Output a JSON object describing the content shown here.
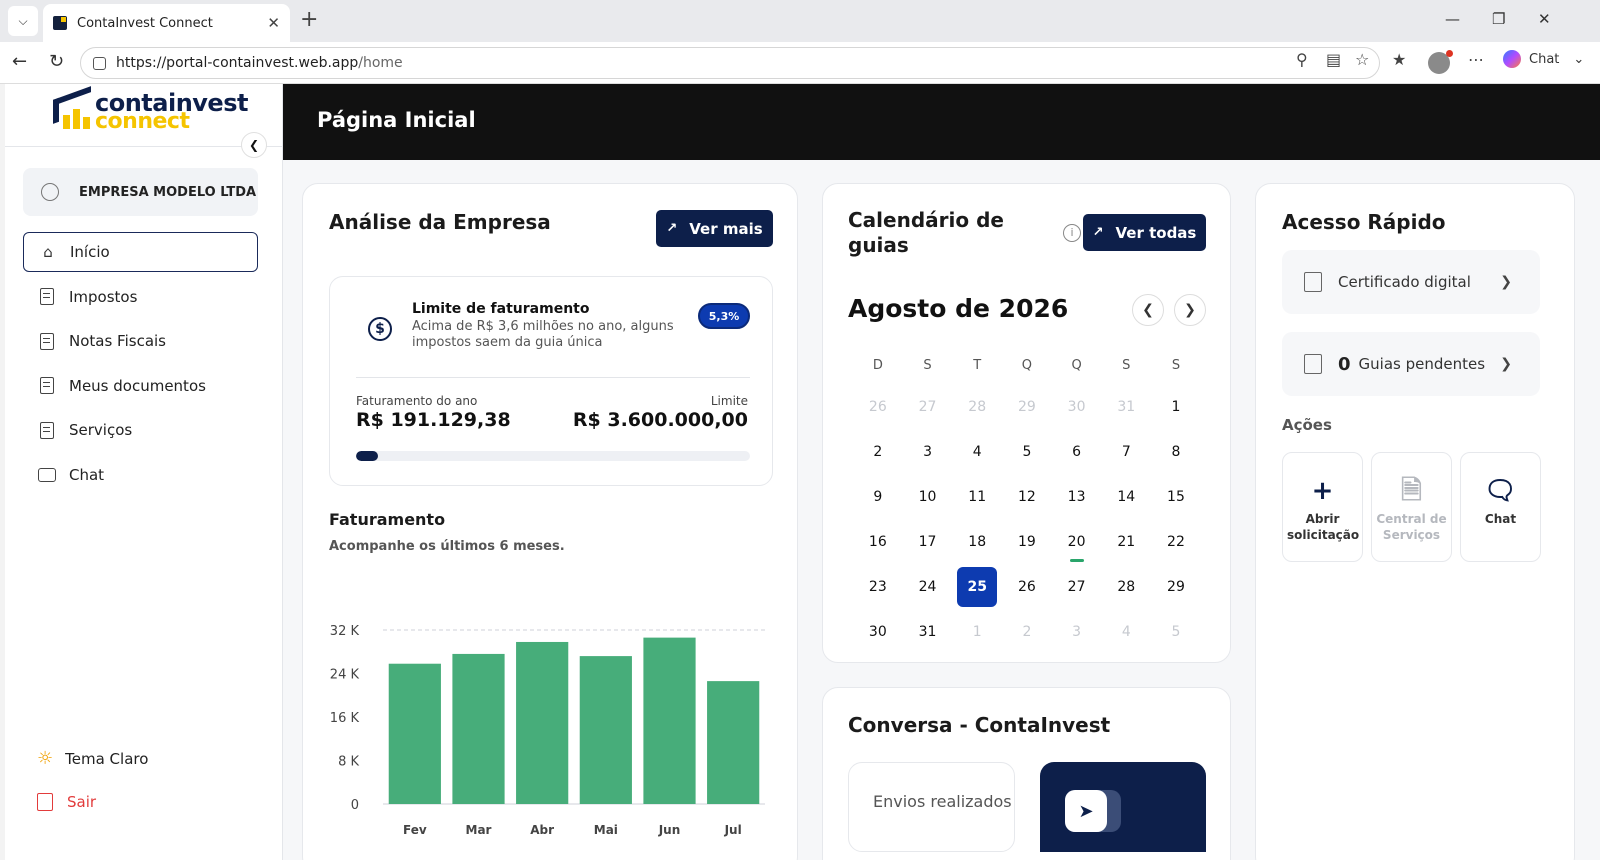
{
  "browser": {
    "tab_title": "ContaInvest Connect",
    "url_host": "https://portal-containvest.web.app",
    "url_path": "/home",
    "chat_label": "Chat"
  },
  "brand": {
    "line1": "containvest",
    "line2": "connect"
  },
  "sidebar": {
    "company": "EMPRESA MODELO LTDA",
    "items": [
      {
        "label": "Início",
        "icon": "home-icon"
      },
      {
        "label": "Impostos",
        "icon": "tax-icon"
      },
      {
        "label": "Notas Fiscais",
        "icon": "invoice-icon"
      },
      {
        "label": "Meus documentos",
        "icon": "document-icon"
      },
      {
        "label": "Serviços",
        "icon": "clipboard-icon"
      },
      {
        "label": "Chat",
        "icon": "chat-icon"
      }
    ],
    "theme_label": "Tema Claro",
    "logout_label": "Sair"
  },
  "header": {
    "title": "Página Inicial"
  },
  "analysis": {
    "title": "Análise da Empresa",
    "button": "Ver mais",
    "limit_title": "Limite de faturamento",
    "limit_desc": "Acima de R$ 3,6 milhões no ano, alguns impostos saem da guia única",
    "percent": "5,3%",
    "progress_fraction": 0.053,
    "revenue_label": "Faturamento do ano",
    "revenue_value": "R$ 191.129,38",
    "limit_label": "Limite",
    "limit_value": "R$ 3.600.000,00",
    "chart_title": "Faturamento",
    "chart_subtitle": "Acompanhe os últimos 6 meses."
  },
  "chart_data": {
    "type": "bar",
    "categories": [
      "Fev",
      "Mar",
      "Abr",
      "Mai",
      "Jun",
      "Jul"
    ],
    "values": [
      25800,
      27600,
      29800,
      27200,
      30600,
      22600
    ],
    "ylim": [
      0,
      32000
    ],
    "yticks": [
      "0",
      "8 K",
      "16 K",
      "24 K",
      "32 K"
    ],
    "ytick_values": [
      0,
      8000,
      16000,
      24000,
      32000
    ],
    "color": "#47ad7a",
    "grid": "dashed top line"
  },
  "calendar": {
    "title": "Calendário de guias",
    "button": "Ver todas",
    "month": "Agosto de 2026",
    "weekdays": [
      "D",
      "S",
      "T",
      "Q",
      "Q",
      "S",
      "S"
    ],
    "weeks": [
      [
        {
          "d": "26",
          "m": 1
        },
        {
          "d": "27",
          "m": 1
        },
        {
          "d": "28",
          "m": 1
        },
        {
          "d": "29",
          "m": 1
        },
        {
          "d": "30",
          "m": 1
        },
        {
          "d": "31",
          "m": 1
        },
        {
          "d": "1"
        }
      ],
      [
        {
          "d": "2"
        },
        {
          "d": "3"
        },
        {
          "d": "4"
        },
        {
          "d": "5"
        },
        {
          "d": "6"
        },
        {
          "d": "7"
        },
        {
          "d": "8"
        }
      ],
      [
        {
          "d": "9"
        },
        {
          "d": "10"
        },
        {
          "d": "11"
        },
        {
          "d": "12"
        },
        {
          "d": "13"
        },
        {
          "d": "14"
        },
        {
          "d": "15"
        }
      ],
      [
        {
          "d": "16"
        },
        {
          "d": "17"
        },
        {
          "d": "18"
        },
        {
          "d": "19"
        },
        {
          "d": "20",
          "e": 1
        },
        {
          "d": "21"
        },
        {
          "d": "22"
        }
      ],
      [
        {
          "d": "23"
        },
        {
          "d": "24"
        },
        {
          "d": "25",
          "t": 1
        },
        {
          "d": "26"
        },
        {
          "d": "27"
        },
        {
          "d": "28"
        },
        {
          "d": "29"
        }
      ],
      [
        {
          "d": "30"
        },
        {
          "d": "31"
        },
        {
          "d": "1",
          "m": 1
        },
        {
          "d": "2",
          "m": 1
        },
        {
          "d": "3",
          "m": 1
        },
        {
          "d": "4",
          "m": 1
        },
        {
          "d": "5",
          "m": 1
        }
      ]
    ]
  },
  "conversa": {
    "title": "Conversa - ContaInvest",
    "sent_label": "Envios realizados"
  },
  "quick": {
    "title": "Acesso Rápido",
    "cert": "Certificado digital",
    "pending_count": "0",
    "pending_label": "Guias pendentes",
    "actions_title": "Ações",
    "actions": [
      {
        "label": "Abrir solicitação",
        "icon": "plus-icon",
        "disabled": false
      },
      {
        "label": "Central de Serviços",
        "icon": "file-arrow-icon",
        "disabled": true
      },
      {
        "label": "Chat",
        "icon": "chat-icon",
        "disabled": false
      }
    ]
  }
}
